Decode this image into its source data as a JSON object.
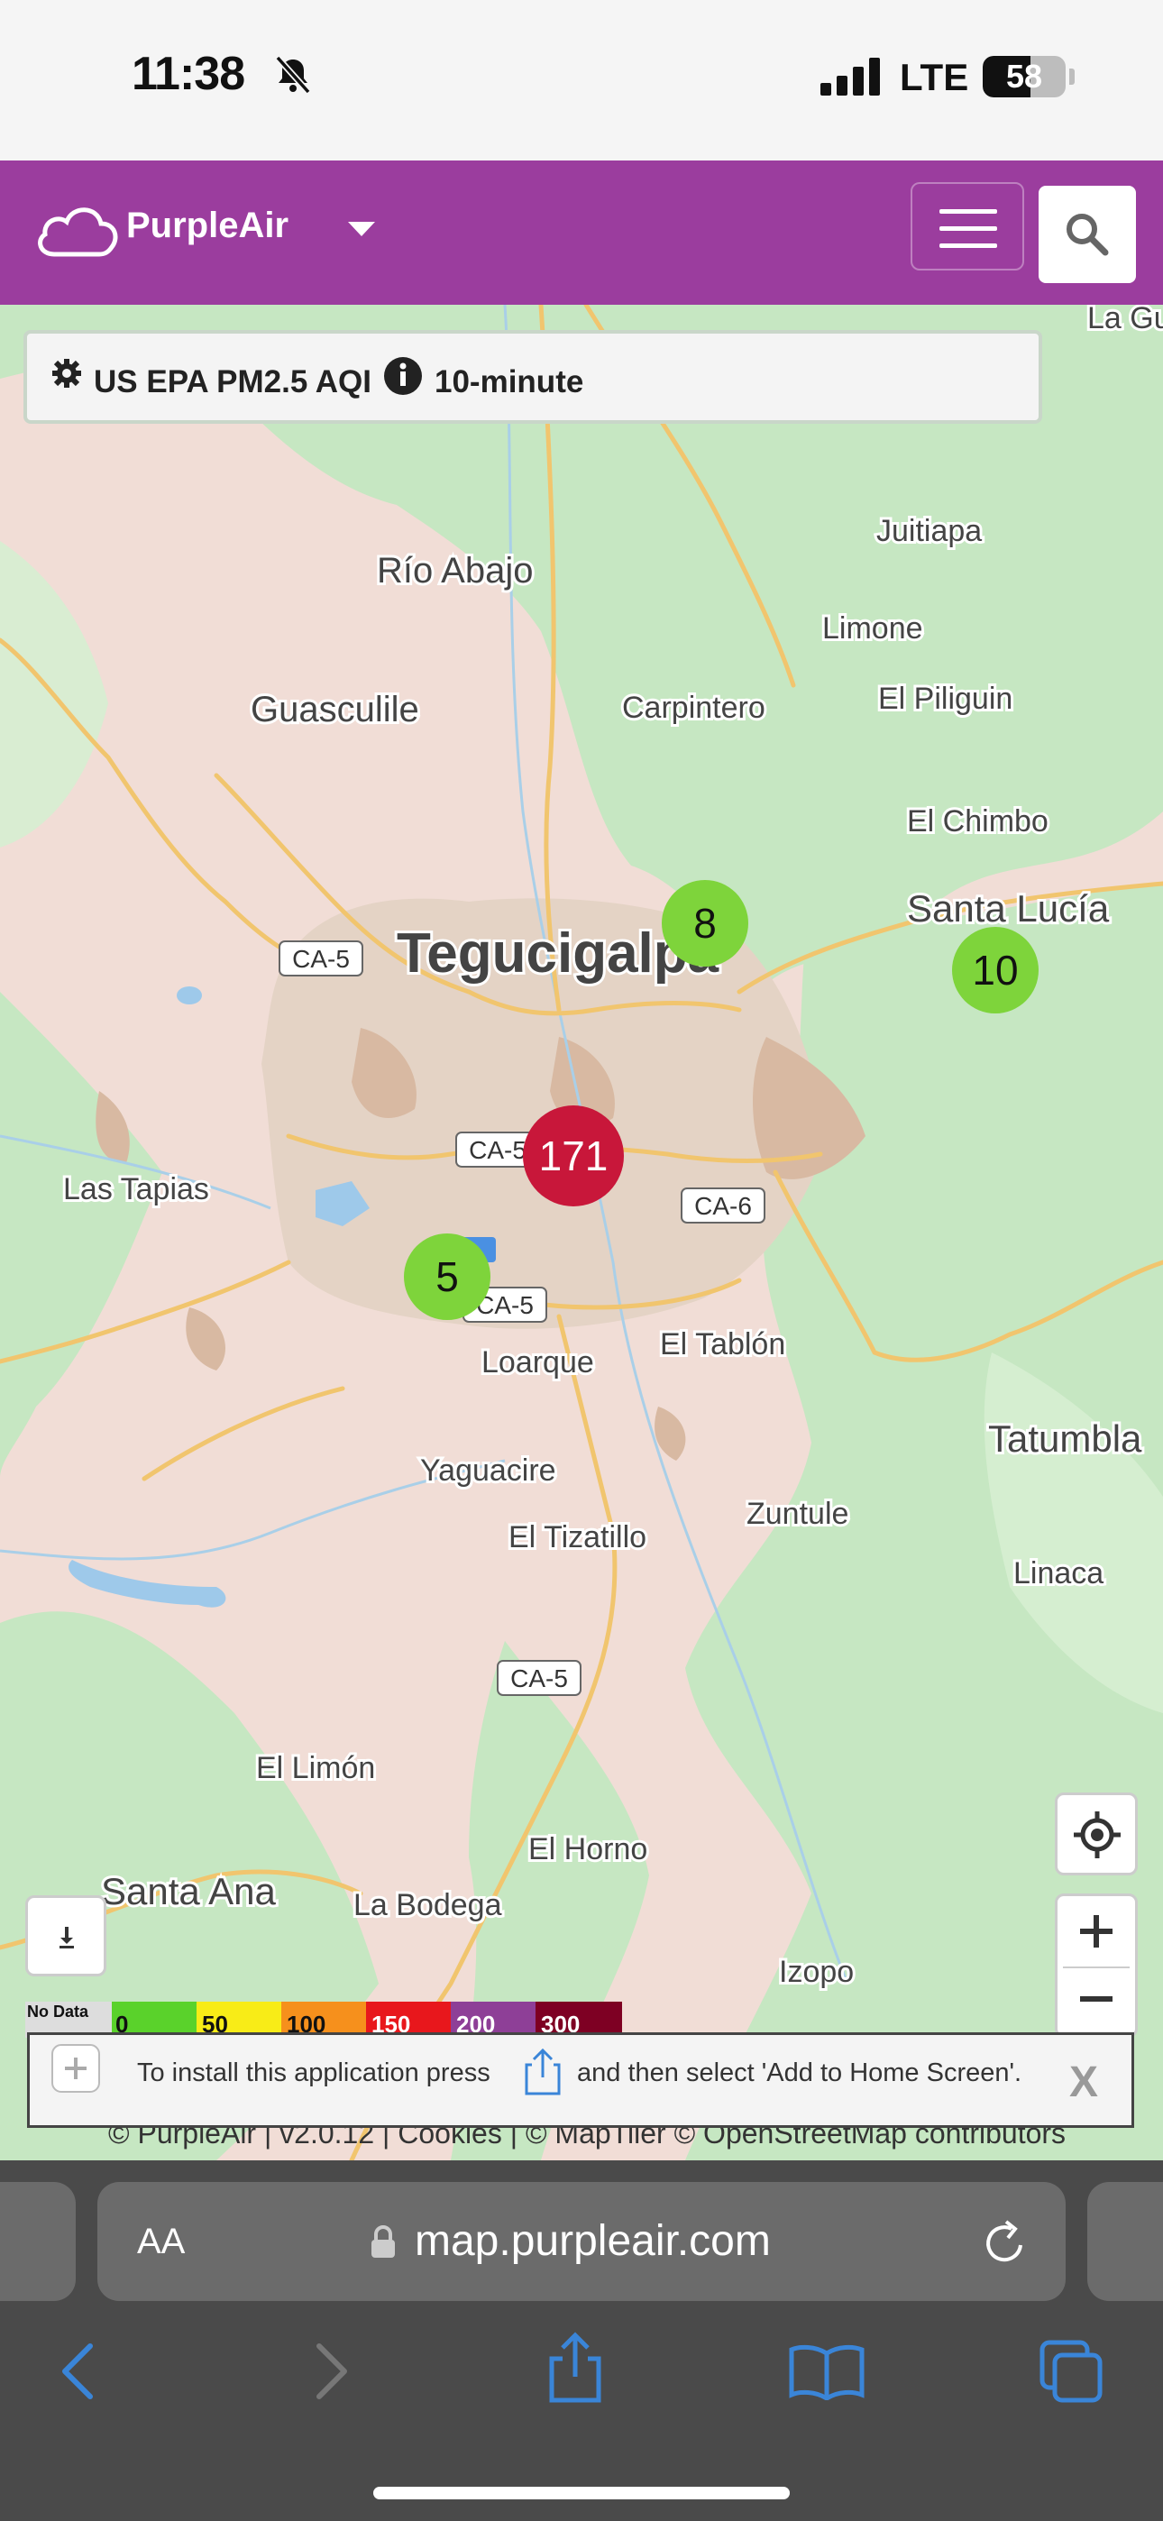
{
  "status_bar": {
    "time": "11:38",
    "network": "LTE",
    "battery": "58",
    "battery_level_percent": 58
  },
  "header": {
    "brand": "PurpleAir"
  },
  "aqi_selector": {
    "label": "US EPA PM2.5 AQI",
    "period": "10-minute"
  },
  "map": {
    "places": [
      {
        "name": "Río Abajo"
      },
      {
        "name": "Guasculile"
      },
      {
        "name": "Carpintero"
      },
      {
        "name": "Juitiapa"
      },
      {
        "name": "Limone"
      },
      {
        "name": "El Piliguin"
      },
      {
        "name": "El Chimbo"
      },
      {
        "name": "Santa Lucía"
      },
      {
        "name": "Tegucigalpa"
      },
      {
        "name": "Las Tapias"
      },
      {
        "name": "El Tablón"
      },
      {
        "name": "Loarque"
      },
      {
        "name": "Yaguacire"
      },
      {
        "name": "El Tizatillo"
      },
      {
        "name": "Zuntule"
      },
      {
        "name": "Tatumbla"
      },
      {
        "name": "Linaca"
      },
      {
        "name": "El Limón"
      },
      {
        "name": "El Horno"
      },
      {
        "name": "Santa Ana"
      },
      {
        "name": "La Bodega"
      },
      {
        "name": "Izopo"
      },
      {
        "name": "La Gu"
      }
    ],
    "road_shields": [
      "CA-5",
      "CA-5",
      "CA-6",
      "CA-5",
      "CA-5"
    ],
    "clusters": [
      {
        "value": "8",
        "color": "#7ed43b"
      },
      {
        "value": "10",
        "color": "#7ed43b"
      },
      {
        "value": "171",
        "color": "#c8173a"
      },
      {
        "value": "5",
        "color": "#7ed43b"
      }
    ]
  },
  "legend": {
    "no_data": "No Data",
    "labels": [
      "0",
      "50",
      "100",
      "150",
      "200",
      "300"
    ],
    "colors": [
      "#5ad22b",
      "#f8ec17",
      "#f6901c",
      "#e8171c",
      "#8e3f97",
      "#7e0023"
    ]
  },
  "install_banner": {
    "text_before": "To install this application press",
    "text_after": "and then select 'Add to Home Screen'.",
    "close": "X"
  },
  "attribution": "© PurpleAir | v2.0.12 | Cookies | © MapTiler © OpenStreetMap contributors",
  "browser": {
    "aa": "AA",
    "url": "map.purpleair.com"
  }
}
